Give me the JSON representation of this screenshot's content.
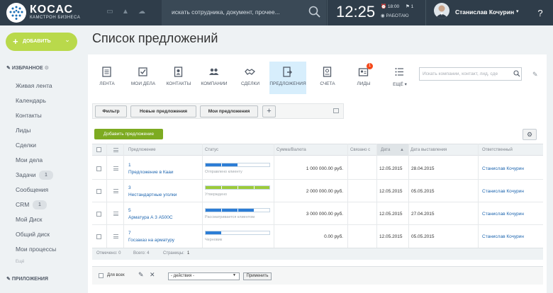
{
  "topbar": {
    "brand": "КОСАС",
    "brand_sub": "КАМСТРОН БИЗНЕСА",
    "search_placeholder": "искать сотрудника, документ, прочее...",
    "clock": "12:25",
    "alarm": "18:00",
    "tasks_count": "1",
    "work_status": "РАБОТАЮ",
    "user_name": "Станислав Кочурин",
    "help": "?"
  },
  "sidebar": {
    "add_label": "ДОБАВИТЬ",
    "favorites_label": "ИЗБРАННОЕ",
    "items": [
      {
        "label": "Живая лента"
      },
      {
        "label": "Календарь"
      },
      {
        "label": "Контакты"
      },
      {
        "label": "Лиды"
      },
      {
        "label": "Сделки"
      },
      {
        "label": "Мои дела"
      },
      {
        "label": "Задачи",
        "badge": "1"
      },
      {
        "label": "Сообщения"
      },
      {
        "label": "CRM",
        "badge": "1"
      },
      {
        "label": "Мой Диск"
      },
      {
        "label": "Общий диск"
      },
      {
        "label": "Мои процессы"
      },
      {
        "label": "Ещё"
      }
    ],
    "apps_label": "ПРИЛОЖЕНИЯ"
  },
  "page": {
    "title": "Список предложений"
  },
  "crm_nav": {
    "items": [
      {
        "label": "ЛЕНТА",
        "icon": "feed-icon"
      },
      {
        "label": "МОИ ДЕЛА",
        "icon": "my-tasks-icon"
      },
      {
        "label": "КОНТАКТЫ",
        "icon": "contacts-icon"
      },
      {
        "label": "КОМПАНИИ",
        "icon": "companies-icon"
      },
      {
        "label": "СДЕЛКИ",
        "icon": "deals-icon"
      },
      {
        "label": "ПРЕДЛОЖЕНИЯ",
        "icon": "quotes-icon",
        "active": true
      },
      {
        "label": "СЧЕТА",
        "icon": "invoices-icon"
      },
      {
        "label": "ЛИДЫ",
        "icon": "leads-icon",
        "badge": "1"
      },
      {
        "label": "ЕЩЁ",
        "icon": "more-icon"
      }
    ],
    "search_placeholder": "Искать компании, контакт, лид, сде"
  },
  "filters": {
    "filter_label": "Фильтр",
    "new_offers_label": "Новые предложения",
    "my_offers_label": "Мои предложения",
    "add_label": "+"
  },
  "toolbar": {
    "add_offer_label": "Добавить предложение"
  },
  "table": {
    "headers": {
      "offer": "Предложение",
      "status": "Статус",
      "sum": "Сумма/Валюта",
      "linked": "Связано с",
      "date": "Дата",
      "date_issued": "Дата выставления",
      "responsible": "Ответственный"
    },
    "rows": [
      {
        "num": "1",
        "title": "Предложение в Кааи",
        "status": "Отправлено клиенту",
        "status_color": "#2c7dd6",
        "progress": 0.5,
        "sum": "1 000 000.00 руб.",
        "date": "12.05.2015",
        "date_issued": "28.04.2015",
        "responsible": "Станислав Кочурин"
      },
      {
        "num": "3",
        "title": "Нестандартные уголки",
        "status": "Утверждено",
        "status_color": "#9ccb3a",
        "progress": 1.0,
        "sum": "2 000 000.00 руб.",
        "date": "12.05.2015",
        "date_issued": "05.05.2015",
        "responsible": "Станислав Кочурин"
      },
      {
        "num": "5",
        "title": "Арматура А 3 А500С",
        "status": "Рассматривается клиентом",
        "status_color": "#2c7dd6",
        "progress": 0.75,
        "sum": "3 000 000.00 руб.",
        "date": "12.05.2015",
        "date_issued": "27.04.2015",
        "responsible": "Станислав Кочурин"
      },
      {
        "num": "7",
        "title": "Госзаказ на арматуру",
        "status": "Черновик",
        "status_color": "#2c7dd6",
        "progress": 0.25,
        "sum": "0.00 руб.",
        "date": "12.05.2015",
        "date_issued": "05.05.2015",
        "responsible": "Станислав Кочурин"
      }
    ]
  },
  "footer": {
    "selected": "Отмечено: 0",
    "total": "Всего: 4",
    "pages": "Страницы:",
    "page_num": "1"
  },
  "actions": {
    "for_all": "Для всех",
    "select_value": "- действия -",
    "apply": "Применить"
  }
}
